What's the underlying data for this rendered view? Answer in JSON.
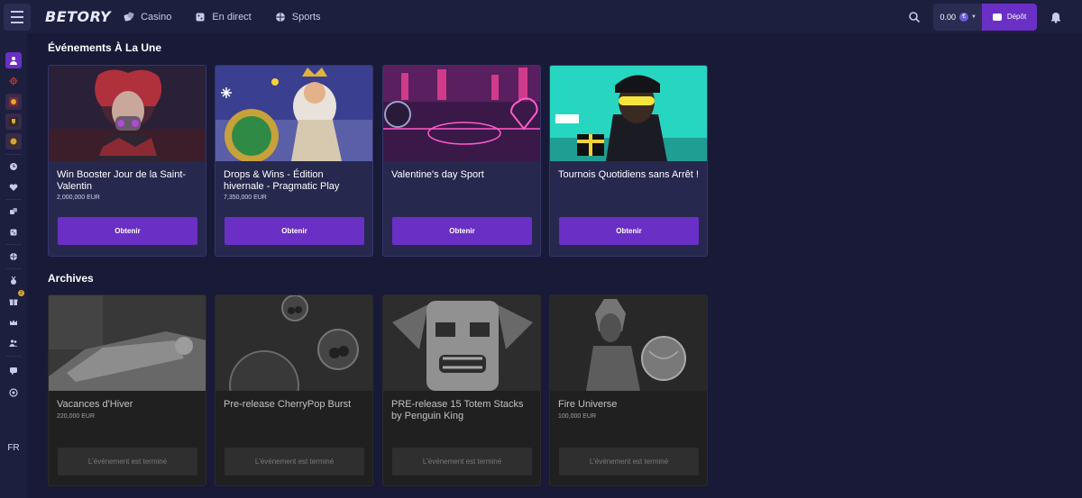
{
  "header": {
    "logo": "BETORY",
    "nav": [
      {
        "label": "Casino",
        "icon": "dice-icon"
      },
      {
        "label": "En direct",
        "icon": "live-dice-icon"
      },
      {
        "label": "Sports",
        "icon": "ball-icon"
      }
    ],
    "balance": "0.00",
    "currency_symbol": "€",
    "deposit_label": "Dépôt"
  },
  "sidebar": {
    "language": "FR",
    "gift_badge": "2"
  },
  "featured": {
    "title": "Événements À La Une",
    "cards": [
      {
        "title": "Win Booster Jour de la Saint-Valentin",
        "amount": "2,000,000 EUR",
        "button": "Obtenir"
      },
      {
        "title": "Drops & Wins - Édition hivernale - Pragmatic Play",
        "amount": "7,350,000 EUR",
        "button": "Obtenir"
      },
      {
        "title": "Valentine's day Sport",
        "amount": "",
        "button": "Obtenir"
      },
      {
        "title": "Tournois Quotidiens sans Arrêt !",
        "amount": "",
        "button": "Obtenir"
      }
    ]
  },
  "archives": {
    "title": "Archives",
    "cards": [
      {
        "title": "Vacances d'Hiver",
        "amount": "220,000 EUR",
        "button": "L'événement est terminé"
      },
      {
        "title": "Pre-release CherryPop Burst",
        "amount": "",
        "button": "L'événement est terminé"
      },
      {
        "title": "PRE-release 15 Totem Stacks by Penguin King",
        "amount": "",
        "button": "L'événement est terminé"
      },
      {
        "title": "Fire Universe",
        "amount": "100,000 EUR",
        "button": "L'événement est terminé"
      }
    ]
  },
  "colors": {
    "background": "#181a37",
    "panel": "#1d1f3f",
    "card": "#26284e",
    "accent": "#6a2fc5",
    "ended_button": "#3b3d61"
  }
}
